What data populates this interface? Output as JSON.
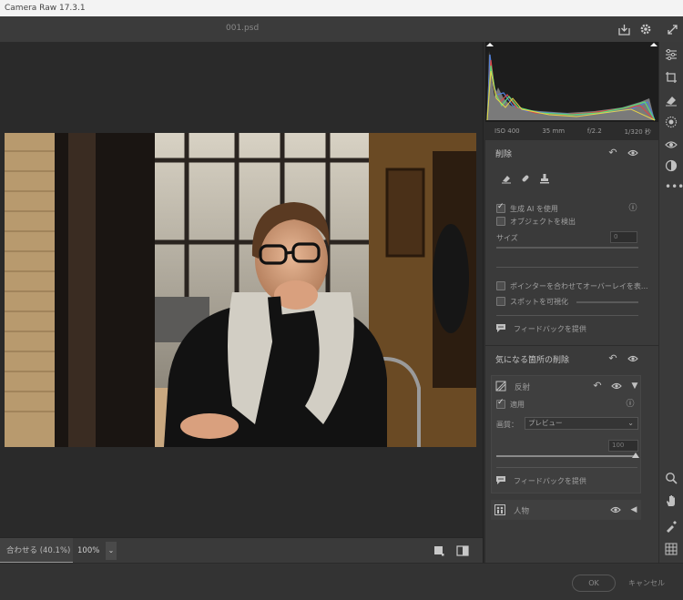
{
  "window": {
    "title": "Camera Raw 17.3.1"
  },
  "topbar": {
    "filename": "001.psd"
  },
  "histogram": {
    "iso": "ISO 400",
    "focal_length": "35 mm",
    "aperture": "f/2.2",
    "shutter": "1/320 秒"
  },
  "remove_panel": {
    "title": "削除",
    "use_generative_ai": "生成 AI を使用",
    "detect_objects": "オブジェクトを検出",
    "size_label": "サイズ",
    "size_value": "0",
    "overlay_on_hover": "ポインターを合わせてオーバーレイを表...",
    "visualize_spots": "スポットを可視化",
    "feedback": "フィードバックを提供"
  },
  "distraction_panel": {
    "title": "気になる箇所の削除",
    "reflection": {
      "label": "反射",
      "apply_label": "適用",
      "quality_label": "画質：",
      "quality_value": "プレビュー",
      "amount_value": "100",
      "feedback": "フィードバックを提供"
    },
    "people": {
      "label": "人物"
    }
  },
  "bottombar": {
    "fit_label": "合わせる (40.1%)",
    "zoom_value": "100%"
  },
  "footer": {
    "ok_label": "OK",
    "cancel_label": "キャンセル"
  },
  "colors": {
    "accent": "#c8c8c8",
    "panel_bg": "#3a3a3a",
    "canvas_bg": "#2a2a2a"
  }
}
